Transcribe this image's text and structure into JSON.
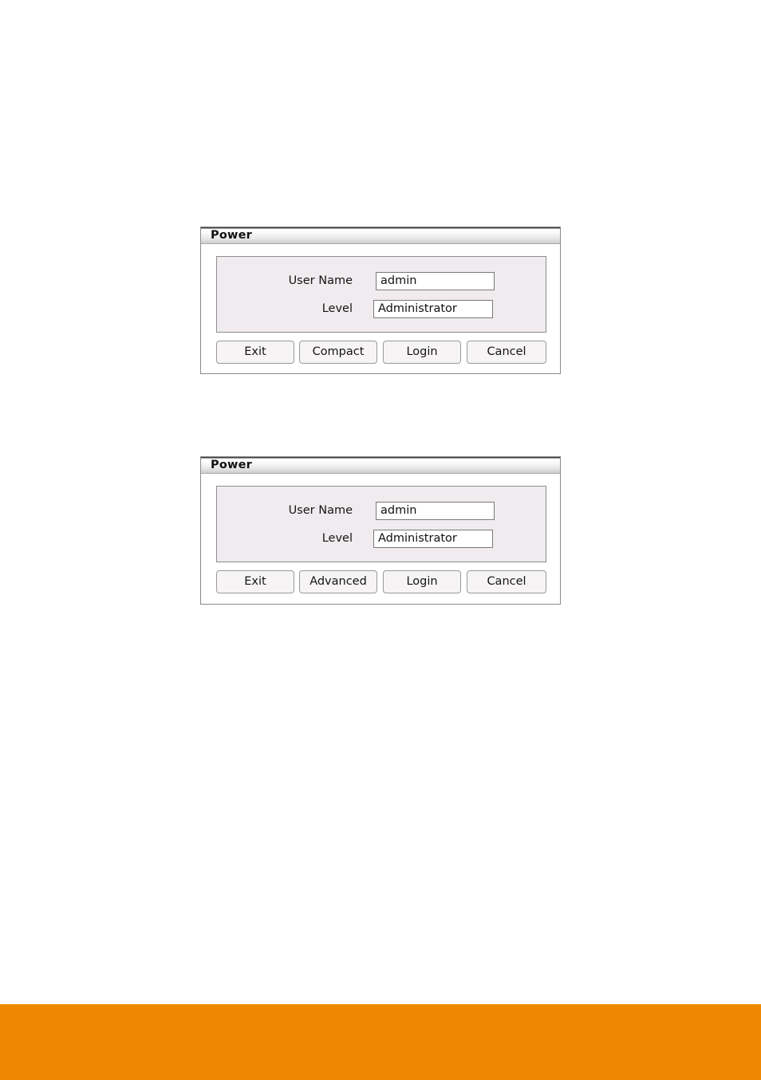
{
  "page": {
    "background_color": "#ffffff",
    "footer_band_color": "#ef8700"
  },
  "dialogs": [
    {
      "id": "compact",
      "title": "Power",
      "fields": [
        {
          "label": "User Name",
          "value": "admin",
          "placeholder": "User Name"
        },
        {
          "label": "Level",
          "value": "Administrator",
          "placeholder": "Level"
        }
      ],
      "buttons": [
        {
          "label": "Exit"
        },
        {
          "label": "Compact"
        },
        {
          "label": "Login"
        },
        {
          "label": "Cancel"
        }
      ]
    },
    {
      "id": "advanced",
      "title": "Power",
      "fields": [
        {
          "label": "User Name",
          "value": "admin",
          "placeholder": "User Name"
        },
        {
          "label": "Level",
          "value": "Administrator",
          "placeholder": "Level"
        }
      ],
      "buttons": [
        {
          "label": "Exit"
        },
        {
          "label": "Advanced"
        },
        {
          "label": "Login"
        },
        {
          "label": "Cancel"
        }
      ]
    }
  ]
}
